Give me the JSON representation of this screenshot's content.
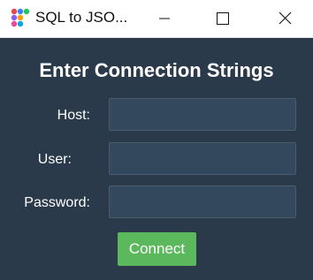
{
  "window": {
    "title": "SQL to JSO...",
    "app_icon": "colored-dots-app-icon",
    "controls": {
      "minimize_icon": "minimize-icon",
      "maximize_icon": "maximize-icon",
      "close_icon": "close-icon"
    }
  },
  "form": {
    "heading": "Enter Connection Strings",
    "fields": [
      {
        "label": "Host:",
        "value": "",
        "placeholder": ""
      },
      {
        "label": "User:",
        "value": "",
        "placeholder": ""
      },
      {
        "label": "Password:",
        "value": "",
        "placeholder": ""
      }
    ],
    "connect_label": "Connect"
  },
  "colors": {
    "panel_background": "#2b3a4b",
    "input_background": "#34485d",
    "connect_button": "#5cb85c",
    "text": "#ffffff"
  }
}
